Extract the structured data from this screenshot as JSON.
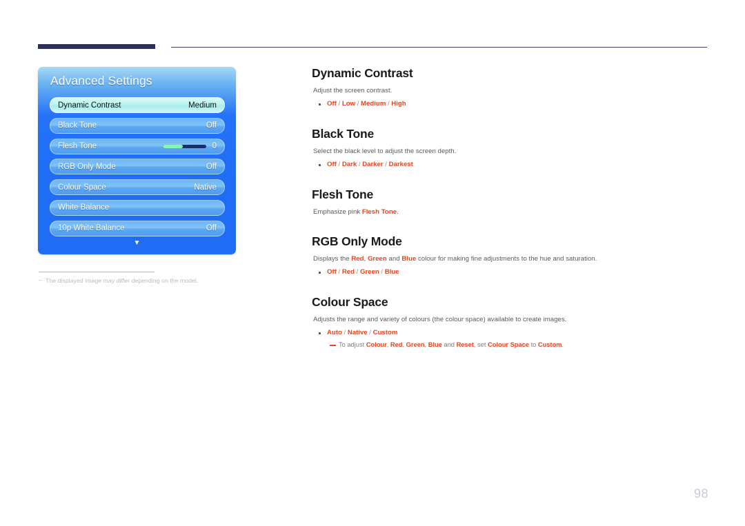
{
  "page": {
    "number": "98"
  },
  "osd": {
    "title": "Advanced Settings",
    "down_arrow_icon": "▼",
    "rows": [
      {
        "label": "Dynamic Contrast",
        "value": "Medium",
        "selected": true,
        "type": "value"
      },
      {
        "label": "Black Tone",
        "value": "Off",
        "selected": false,
        "type": "value"
      },
      {
        "label": "Flesh Tone",
        "value": "0",
        "selected": false,
        "type": "slider",
        "slider_percent": 47
      },
      {
        "label": "RGB Only Mode",
        "value": "Off",
        "selected": false,
        "type": "value"
      },
      {
        "label": "Colour Space",
        "value": "Native",
        "selected": false,
        "type": "value"
      },
      {
        "label": "White Balance",
        "value": "",
        "selected": false,
        "type": "value"
      },
      {
        "label": "10p White Balance",
        "value": "Off",
        "selected": false,
        "type": "value"
      }
    ]
  },
  "footnote": {
    "dash": "‒",
    "text": "The displayed image may differ depending on the model."
  },
  "sections": {
    "dynamic_contrast": {
      "title": "Dynamic Contrast",
      "desc": "Adjust the screen contrast.",
      "options": [
        "Off",
        "Low",
        "Medium",
        "High"
      ]
    },
    "black_tone": {
      "title": "Black Tone",
      "desc": "Select the black level to adjust the screen depth.",
      "options": [
        "Off",
        "Dark",
        "Darker",
        "Darkest"
      ]
    },
    "flesh_tone": {
      "title": "Flesh Tone",
      "desc_pre": "Emphasize pink ",
      "desc_kw": "Flesh Tone",
      "desc_post": "."
    },
    "rgb_only_mode": {
      "title": "RGB Only Mode",
      "desc_1": "Displays the ",
      "desc_kw1": "Red",
      "desc_2": ", ",
      "desc_kw2": "Green",
      "desc_3": " and ",
      "desc_kw3": "Blue",
      "desc_4": " colour for making fine adjustments to the hue and saturation.",
      "options": [
        "Off",
        "Red",
        "Green",
        "Blue"
      ]
    },
    "colour_space": {
      "title": "Colour Space",
      "desc": "Adjusts the range and variety of colours (the colour space) available to create images.",
      "options": [
        "Auto",
        "Native",
        "Custom"
      ],
      "note_1": "To adjust ",
      "note_kw1": "Colour",
      "note_2": ", ",
      "note_kw2": "Red",
      "note_3": ", ",
      "note_kw3": "Green",
      "note_4": ", ",
      "note_kw4": "Blue",
      "note_5": " and ",
      "note_kw5": "Reset",
      "note_6": ", set ",
      "note_kw6": "Colour Space",
      "note_7": " to ",
      "note_kw7": "Custom",
      "note_8": "."
    }
  },
  "colors": {
    "accent_red": "#e8441e",
    "header_bar": "#2e3057",
    "osd_blue": "#1f6df5",
    "osd_selected": "#b8f3ee",
    "slider_fill": "#87f5b8",
    "slider_track": "#16306b"
  }
}
